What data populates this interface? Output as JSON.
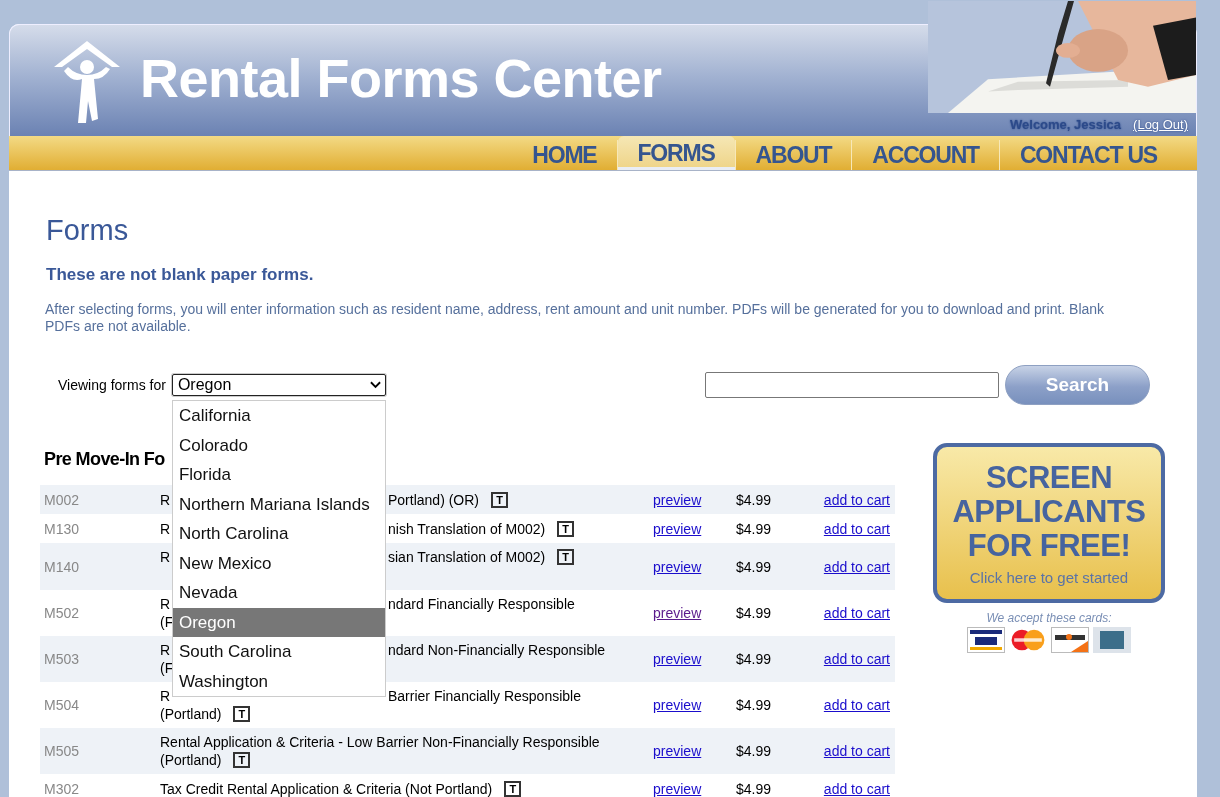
{
  "header": {
    "logo_text": "Rental Forms Center",
    "welcome": "Welcome, Jessica",
    "logout": "(Log Out)"
  },
  "nav": [
    {
      "label": "HOME",
      "selected": false
    },
    {
      "label": "FORMS",
      "selected": true
    },
    {
      "label": "ABOUT",
      "selected": false
    },
    {
      "label": "ACCOUNT",
      "selected": false
    },
    {
      "label": "CONTACT US",
      "selected": false
    }
  ],
  "title": "Forms",
  "subtitle": "These are not blank paper forms.",
  "intro": "After selecting forms, you will enter information such as resident name, address, rent amount and unit number. PDFs will be generated for you to download and print. Blank PDFs are not available.",
  "state_filter": {
    "label": "Viewing forms for",
    "value": "Oregon",
    "expanded": true,
    "options": [
      {
        "label": "California",
        "selected": false
      },
      {
        "label": "Colorado",
        "selected": false
      },
      {
        "label": "Florida",
        "selected": false
      },
      {
        "label": "Northern Mariana Islands",
        "selected": false
      },
      {
        "label": "North Carolina",
        "selected": false
      },
      {
        "label": "New Mexico",
        "selected": false
      },
      {
        "label": "Nevada",
        "selected": false
      },
      {
        "label": "Oregon",
        "selected": true
      },
      {
        "label": "South Carolina",
        "selected": false
      },
      {
        "label": "Washington",
        "selected": false
      }
    ]
  },
  "search": {
    "button": "Search"
  },
  "section_title": "Pre Move-In Fo",
  "rows": [
    {
      "code": "M002",
      "lines": [
        {
          "start": "R",
          "end": "Portland) (OR)"
        }
      ],
      "badge": "T",
      "preview": "preview",
      "visited": false,
      "price": "$4.99",
      "action": "add to cart"
    },
    {
      "code": "M130",
      "lines": [
        {
          "start": "R",
          "end": "nish Translation of M002)"
        }
      ],
      "badge": "T",
      "preview": "preview",
      "visited": false,
      "price": "$4.99",
      "action": "add to cart"
    },
    {
      "code": "M140",
      "lines": [
        {
          "start": "R",
          "end": "sian Translation of M002)"
        }
      ],
      "badge": "T",
      "preview": "preview",
      "visited": false,
      "price": "$4.99",
      "action": "add to cart"
    },
    {
      "code": "M502",
      "lines": [
        {
          "start": "R",
          "end": "ndard Financially Responsible"
        },
        {
          "start": "(F"
        }
      ],
      "preview": "preview",
      "visited": true,
      "price": "$4.99",
      "action": "add to cart"
    },
    {
      "code": "M503",
      "lines": [
        {
          "start": "R",
          "end": "ndard Non-Financially Responsible"
        },
        {
          "start": "(F"
        }
      ],
      "preview": "preview",
      "visited": false,
      "price": "$4.99",
      "action": "add to cart"
    },
    {
      "code": "M504",
      "lines": [
        {
          "start": "R",
          "end": "Barrier Financially Responsible"
        },
        {
          "text": "(Portland)"
        }
      ],
      "badge": "T",
      "preview": "preview",
      "visited": false,
      "price": "$4.99",
      "action": "add to cart"
    },
    {
      "code": "M505",
      "lines": [
        {
          "text": "Rental Application & Criteria - Low Barrier Non-Financially Responsible"
        },
        {
          "text": "(Portland)"
        }
      ],
      "badge": "T",
      "preview": "preview",
      "visited": false,
      "price": "$4.99",
      "action": "add to cart"
    },
    {
      "code": "M302",
      "lines": [
        {
          "text": "Tax Credit Rental Application & Criteria (Not Portland)"
        }
      ],
      "badge": "T",
      "preview": "preview",
      "visited": false,
      "price": "$4.99",
      "action": "add to cart"
    }
  ],
  "promo": {
    "headline": "SCREEN APPLICANTS FOR FREE!",
    "cta": "Click here to get started"
  },
  "cards_note": "We accept these cards:"
}
